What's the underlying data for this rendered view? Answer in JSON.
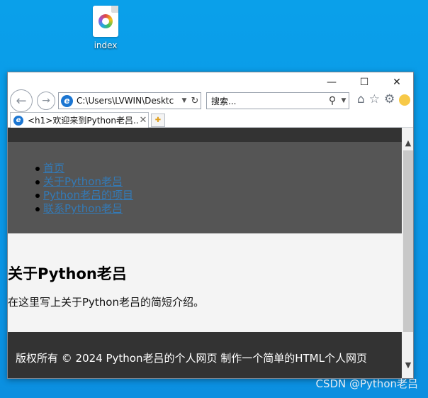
{
  "desktop": {
    "icon_label": "index"
  },
  "browser": {
    "controls": {
      "minimize": "—",
      "maximize": "☐",
      "close": "✕"
    },
    "address": "C:\\Users\\LVWIN\\Desktc",
    "search_placeholder": "搜索...",
    "tab_title": "<h1>欢迎来到Python老吕..."
  },
  "page": {
    "nav": [
      "首页",
      "关于Python老吕",
      "Python老吕的项目",
      "联系Python老吕"
    ],
    "heading": "关于Python老吕",
    "intro": "在这里写上关于Python老吕的简短介绍。",
    "footer": "版权所有 © 2024 Python老吕的个人网页 制作一个简单的HTML个人网页"
  },
  "watermark": "CSDN @Python老吕",
  "colors": {
    "desktop_bg": "#0a9be8",
    "header_bg": "#555555",
    "footer_bg": "#333333",
    "link": "#337ab7"
  }
}
